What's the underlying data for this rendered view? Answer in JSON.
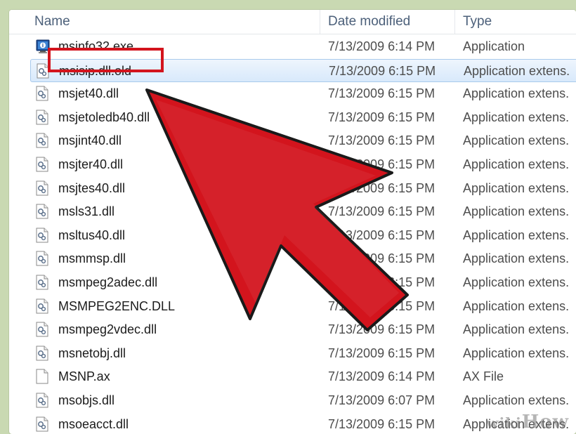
{
  "columns": {
    "name": "Name",
    "date": "Date modified",
    "type": "Type"
  },
  "files": [
    {
      "name": "msinfo32.exe",
      "date": "7/13/2009 6:14 PM",
      "type": "Application",
      "icon": "msinfo-exe-icon",
      "selected": false
    },
    {
      "name": "msisip.dll.old",
      "date": "7/13/2009 6:15 PM",
      "type": "Application extens.",
      "icon": "dll-file-icon",
      "selected": true
    },
    {
      "name": "msjet40.dll",
      "date": "7/13/2009 6:15 PM",
      "type": "Application extens.",
      "icon": "dll-file-icon",
      "selected": false
    },
    {
      "name": "msjetoledb40.dll",
      "date": "7/13/2009 6:15 PM",
      "type": "Application extens.",
      "icon": "dll-file-icon",
      "selected": false
    },
    {
      "name": "msjint40.dll",
      "date": "7/13/2009 6:15 PM",
      "type": "Application extens.",
      "icon": "dll-file-icon",
      "selected": false
    },
    {
      "name": "msjter40.dll",
      "date": "7/13/2009 6:15 PM",
      "type": "Application extens.",
      "icon": "dll-file-icon",
      "selected": false
    },
    {
      "name": "msjtes40.dll",
      "date": "7/13/2009 6:15 PM",
      "type": "Application extens.",
      "icon": "dll-file-icon",
      "selected": false
    },
    {
      "name": "msls31.dll",
      "date": "7/13/2009 6:15 PM",
      "type": "Application extens.",
      "icon": "dll-file-icon",
      "selected": false
    },
    {
      "name": "msltus40.dll",
      "date": "7/13/2009 6:15 PM",
      "type": "Application extens.",
      "icon": "dll-file-icon",
      "selected": false
    },
    {
      "name": "msmmsp.dll",
      "date": "7/13/2009 6:15 PM",
      "type": "Application extens.",
      "icon": "dll-file-icon",
      "selected": false
    },
    {
      "name": "msmpeg2adec.dll",
      "date": "7/13/2009 6:15 PM",
      "type": "Application extens.",
      "icon": "dll-file-icon",
      "selected": false
    },
    {
      "name": "MSMPEG2ENC.DLL",
      "date": "7/13/2009 6:15 PM",
      "type": "Application extens.",
      "icon": "dll-file-icon",
      "selected": false
    },
    {
      "name": "msmpeg2vdec.dll",
      "date": "7/13/2009 6:15 PM",
      "type": "Application extens.",
      "icon": "dll-file-icon",
      "selected": false
    },
    {
      "name": "msnetobj.dll",
      "date": "7/13/2009 6:15 PM",
      "type": "Application extens.",
      "icon": "dll-file-icon",
      "selected": false
    },
    {
      "name": "MSNP.ax",
      "date": "7/13/2009 6:14 PM",
      "type": "AX File",
      "icon": "blank-file-icon",
      "selected": false
    },
    {
      "name": "msobjs.dll",
      "date": "7/13/2009 6:07 PM",
      "type": "Application extens.",
      "icon": "dll-file-icon",
      "selected": false
    },
    {
      "name": "msoeacct.dll",
      "date": "7/13/2009 6:15 PM",
      "type": "Application extens.",
      "icon": "dll-file-icon",
      "selected": false
    }
  ],
  "watermark": {
    "wiki": "wiki",
    "how": "How"
  },
  "colors": {
    "highlight_box": "#d3141d",
    "arrow": "#d3141d",
    "selection": "#d8e9fb"
  }
}
